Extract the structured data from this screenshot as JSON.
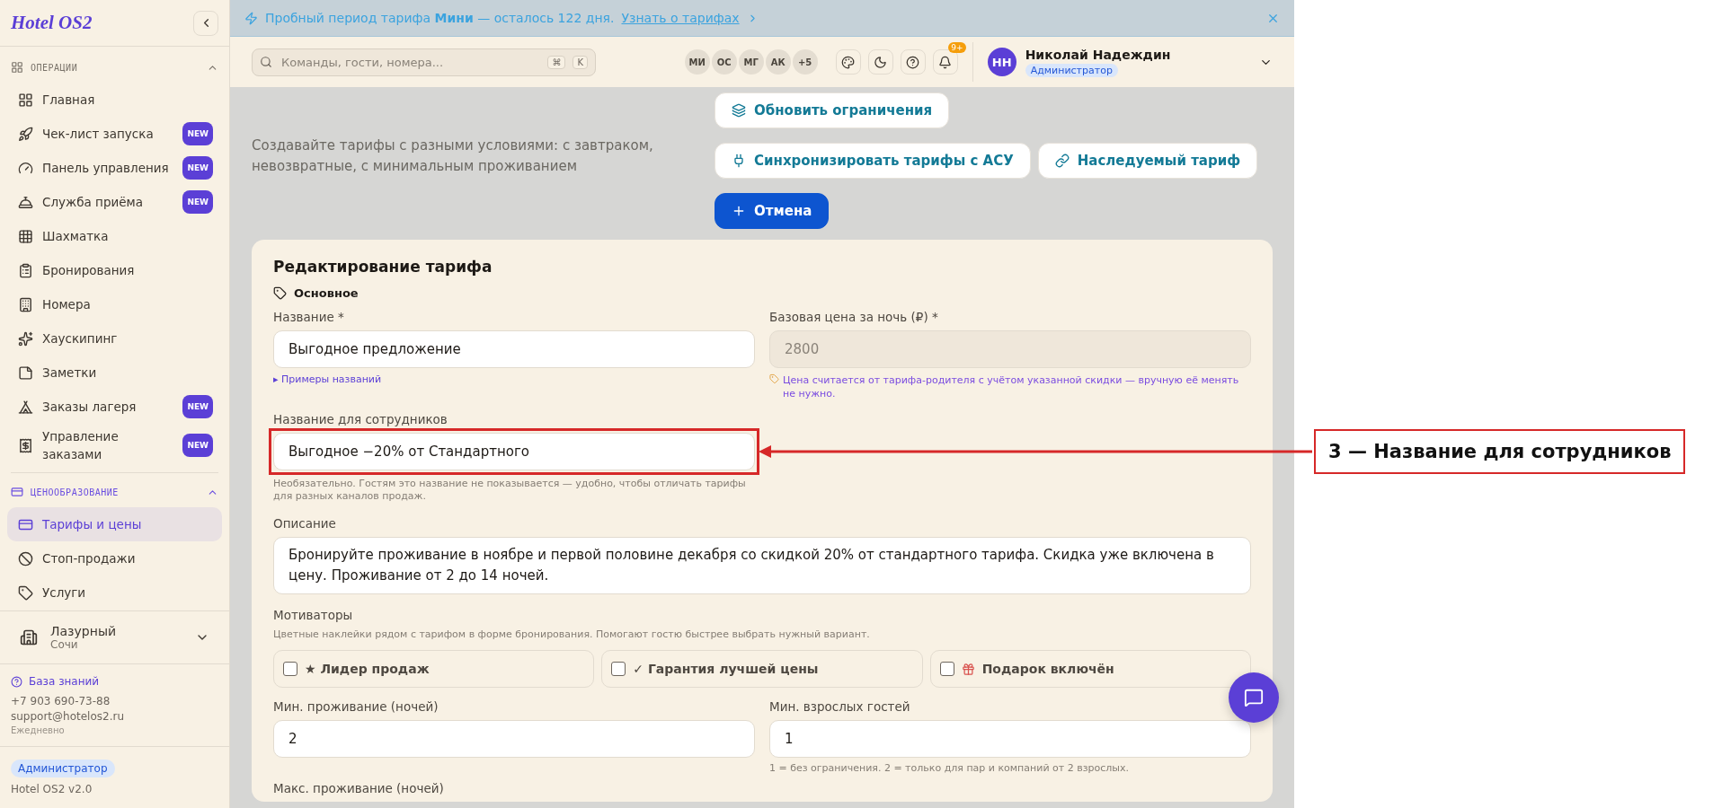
{
  "sidebar": {
    "logo": "Hotel OS2",
    "sections": [
      {
        "title": "ОПЕРАЦИИ",
        "expanded": true,
        "items": [
          {
            "label": "Главная",
            "selected": false
          },
          {
            "label": "Чек-лист запуска",
            "badge": "NEW",
            "selected": false
          },
          {
            "label": "Панель управления",
            "badge": "NEW",
            "selected": false
          },
          {
            "label": "Служба приёма",
            "badge": "NEW",
            "selected": false
          },
          {
            "label": "Шахматка",
            "selected": false
          },
          {
            "label": "Бронирования",
            "selected": false
          },
          {
            "label": "Номера",
            "selected": false
          },
          {
            "label": "Хаускипинг",
            "selected": false
          },
          {
            "label": "Заметки",
            "selected": false
          },
          {
            "label": "Заказы лагеря",
            "badge": "NEW",
            "selected": false
          },
          {
            "label": "Управление заказами",
            "badge": "NEW",
            "selected": false
          }
        ]
      },
      {
        "title": "ЦЕНООБРАЗОВАНИЕ",
        "expanded": true,
        "items": [
          {
            "label": "Тарифы и цены",
            "selected": true
          },
          {
            "label": "Стоп-продажи",
            "selected": false
          },
          {
            "label": "Услуги",
            "selected": false
          }
        ]
      }
    ],
    "property": {
      "name": "Лазурный",
      "city": "Сочи"
    },
    "support": {
      "link": "База знаний",
      "phone": "+7 903 690-73-88",
      "email": "support@hotelos2.ru",
      "hours": "Ежедневно"
    },
    "footer": {
      "role": "Администратор",
      "version": "Hotel OS2 v2.0"
    }
  },
  "banner": {
    "text": "Пробный период тарифа **Мини** — осталось 122 дня.",
    "link": "Узнать о тарифах"
  },
  "header": {
    "search_placeholder": "Команды, гости, номера...",
    "shortcut": [
      "⌘",
      "K"
    ],
    "avatars": [
      "МИ",
      "ОС",
      "МГ",
      "АК"
    ],
    "more": "+5",
    "notifications": "9+",
    "user": {
      "initials": "НН",
      "name": "Николай Надеждин",
      "role": "Администратор"
    }
  },
  "page": {
    "description": "Создавайте тарифы с разными условиями: с завтраком, невозвратные, с минимальным проживанием",
    "actions": [
      {
        "label": "Обновить ограничения",
        "kind": "secondary"
      },
      {
        "label": "Синхронизировать тарифы с АСУ",
        "kind": "secondary"
      },
      {
        "label": "Наследуемый тариф",
        "kind": "secondary"
      },
      {
        "label": "Отмена",
        "kind": "primary"
      }
    ]
  },
  "form": {
    "title": "Редактирование тарифа",
    "section": "Основное",
    "name": {
      "label": "Название *",
      "value": "Выгодное предложение",
      "hint_link": "▸ Примеры названий"
    },
    "base_price": {
      "label": "Базовая цена за ночь (₽) *",
      "value": "2800",
      "disabled": true,
      "note": "Цена считается от тарифа-родителя с учётом указанной скидки — вручную её менять не нужно."
    },
    "staff_name": {
      "label": "Название для сотрудников",
      "value": "Выгодное −20% от Стандартного",
      "highlighted": true,
      "hint": "Необязательно. Гостям это название не показывается — удобно, чтобы отличать тарифы для разных каналов продаж."
    },
    "description": {
      "label": "Описание",
      "value": "Бронируйте проживание в ноябре и первой половине декабря со скидкой 20% от стандартного тарифа. Скидка уже включена в цену. Проживание от 2 до 14 ночей."
    },
    "motivators": {
      "label": "Мотиваторы",
      "hint": "Цветные наклейки рядом с тарифом в форме бронирования. Помогают гостю быстрее выбрать нужный вариант.",
      "options": [
        {
          "label": "★ Лидер продаж",
          "checked": false
        },
        {
          "label": "✓ Гарантия лучшей цены",
          "checked": false
        },
        {
          "label": "Подарок включён",
          "checked": false
        }
      ]
    },
    "min_stay": {
      "label": "Мин. проживание (ночей)",
      "value": "2"
    },
    "min_adults": {
      "label": "Мин. взрослых гостей",
      "value": "1",
      "hint": "1 = без ограничения. 2 = только для пар и компаний от 2 взрослых."
    },
    "max_stay": {
      "label": "Макс. проживание (ночей)"
    }
  },
  "annotation": {
    "label": "3 — Название для сотрудников"
  }
}
